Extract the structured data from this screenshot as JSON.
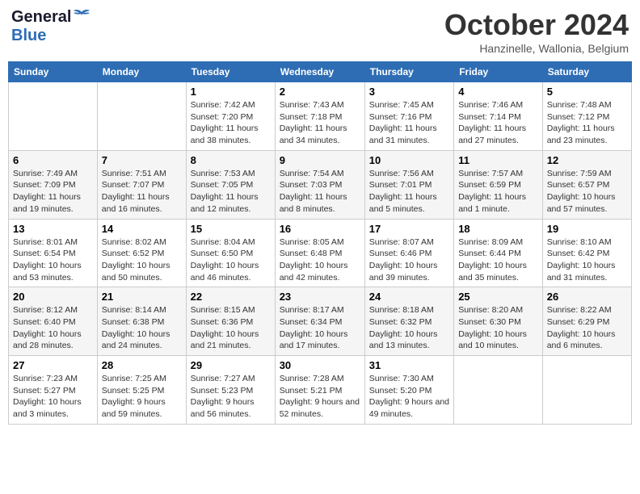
{
  "header": {
    "logo_general": "General",
    "logo_blue": "Blue",
    "month_title": "October 2024",
    "location": "Hanzinelle, Wallonia, Belgium"
  },
  "days_of_week": [
    "Sunday",
    "Monday",
    "Tuesday",
    "Wednesday",
    "Thursday",
    "Friday",
    "Saturday"
  ],
  "weeks": [
    {
      "days": [
        {
          "number": "",
          "info": ""
        },
        {
          "number": "",
          "info": ""
        },
        {
          "number": "1",
          "info": "Sunrise: 7:42 AM\nSunset: 7:20 PM\nDaylight: 11 hours and 38 minutes."
        },
        {
          "number": "2",
          "info": "Sunrise: 7:43 AM\nSunset: 7:18 PM\nDaylight: 11 hours and 34 minutes."
        },
        {
          "number": "3",
          "info": "Sunrise: 7:45 AM\nSunset: 7:16 PM\nDaylight: 11 hours and 31 minutes."
        },
        {
          "number": "4",
          "info": "Sunrise: 7:46 AM\nSunset: 7:14 PM\nDaylight: 11 hours and 27 minutes."
        },
        {
          "number": "5",
          "info": "Sunrise: 7:48 AM\nSunset: 7:12 PM\nDaylight: 11 hours and 23 minutes."
        }
      ]
    },
    {
      "days": [
        {
          "number": "6",
          "info": "Sunrise: 7:49 AM\nSunset: 7:09 PM\nDaylight: 11 hours and 19 minutes."
        },
        {
          "number": "7",
          "info": "Sunrise: 7:51 AM\nSunset: 7:07 PM\nDaylight: 11 hours and 16 minutes."
        },
        {
          "number": "8",
          "info": "Sunrise: 7:53 AM\nSunset: 7:05 PM\nDaylight: 11 hours and 12 minutes."
        },
        {
          "number": "9",
          "info": "Sunrise: 7:54 AM\nSunset: 7:03 PM\nDaylight: 11 hours and 8 minutes."
        },
        {
          "number": "10",
          "info": "Sunrise: 7:56 AM\nSunset: 7:01 PM\nDaylight: 11 hours and 5 minutes."
        },
        {
          "number": "11",
          "info": "Sunrise: 7:57 AM\nSunset: 6:59 PM\nDaylight: 11 hours and 1 minute."
        },
        {
          "number": "12",
          "info": "Sunrise: 7:59 AM\nSunset: 6:57 PM\nDaylight: 10 hours and 57 minutes."
        }
      ]
    },
    {
      "days": [
        {
          "number": "13",
          "info": "Sunrise: 8:01 AM\nSunset: 6:54 PM\nDaylight: 10 hours and 53 minutes."
        },
        {
          "number": "14",
          "info": "Sunrise: 8:02 AM\nSunset: 6:52 PM\nDaylight: 10 hours and 50 minutes."
        },
        {
          "number": "15",
          "info": "Sunrise: 8:04 AM\nSunset: 6:50 PM\nDaylight: 10 hours and 46 minutes."
        },
        {
          "number": "16",
          "info": "Sunrise: 8:05 AM\nSunset: 6:48 PM\nDaylight: 10 hours and 42 minutes."
        },
        {
          "number": "17",
          "info": "Sunrise: 8:07 AM\nSunset: 6:46 PM\nDaylight: 10 hours and 39 minutes."
        },
        {
          "number": "18",
          "info": "Sunrise: 8:09 AM\nSunset: 6:44 PM\nDaylight: 10 hours and 35 minutes."
        },
        {
          "number": "19",
          "info": "Sunrise: 8:10 AM\nSunset: 6:42 PM\nDaylight: 10 hours and 31 minutes."
        }
      ]
    },
    {
      "days": [
        {
          "number": "20",
          "info": "Sunrise: 8:12 AM\nSunset: 6:40 PM\nDaylight: 10 hours and 28 minutes."
        },
        {
          "number": "21",
          "info": "Sunrise: 8:14 AM\nSunset: 6:38 PM\nDaylight: 10 hours and 24 minutes."
        },
        {
          "number": "22",
          "info": "Sunrise: 8:15 AM\nSunset: 6:36 PM\nDaylight: 10 hours and 21 minutes."
        },
        {
          "number": "23",
          "info": "Sunrise: 8:17 AM\nSunset: 6:34 PM\nDaylight: 10 hours and 17 minutes."
        },
        {
          "number": "24",
          "info": "Sunrise: 8:18 AM\nSunset: 6:32 PM\nDaylight: 10 hours and 13 minutes."
        },
        {
          "number": "25",
          "info": "Sunrise: 8:20 AM\nSunset: 6:30 PM\nDaylight: 10 hours and 10 minutes."
        },
        {
          "number": "26",
          "info": "Sunrise: 8:22 AM\nSunset: 6:29 PM\nDaylight: 10 hours and 6 minutes."
        }
      ]
    },
    {
      "days": [
        {
          "number": "27",
          "info": "Sunrise: 7:23 AM\nSunset: 5:27 PM\nDaylight: 10 hours and 3 minutes."
        },
        {
          "number": "28",
          "info": "Sunrise: 7:25 AM\nSunset: 5:25 PM\nDaylight: 9 hours and 59 minutes."
        },
        {
          "number": "29",
          "info": "Sunrise: 7:27 AM\nSunset: 5:23 PM\nDaylight: 9 hours and 56 minutes."
        },
        {
          "number": "30",
          "info": "Sunrise: 7:28 AM\nSunset: 5:21 PM\nDaylight: 9 hours and 52 minutes."
        },
        {
          "number": "31",
          "info": "Sunrise: 7:30 AM\nSunset: 5:20 PM\nDaylight: 9 hours and 49 minutes."
        },
        {
          "number": "",
          "info": ""
        },
        {
          "number": "",
          "info": ""
        }
      ]
    }
  ]
}
